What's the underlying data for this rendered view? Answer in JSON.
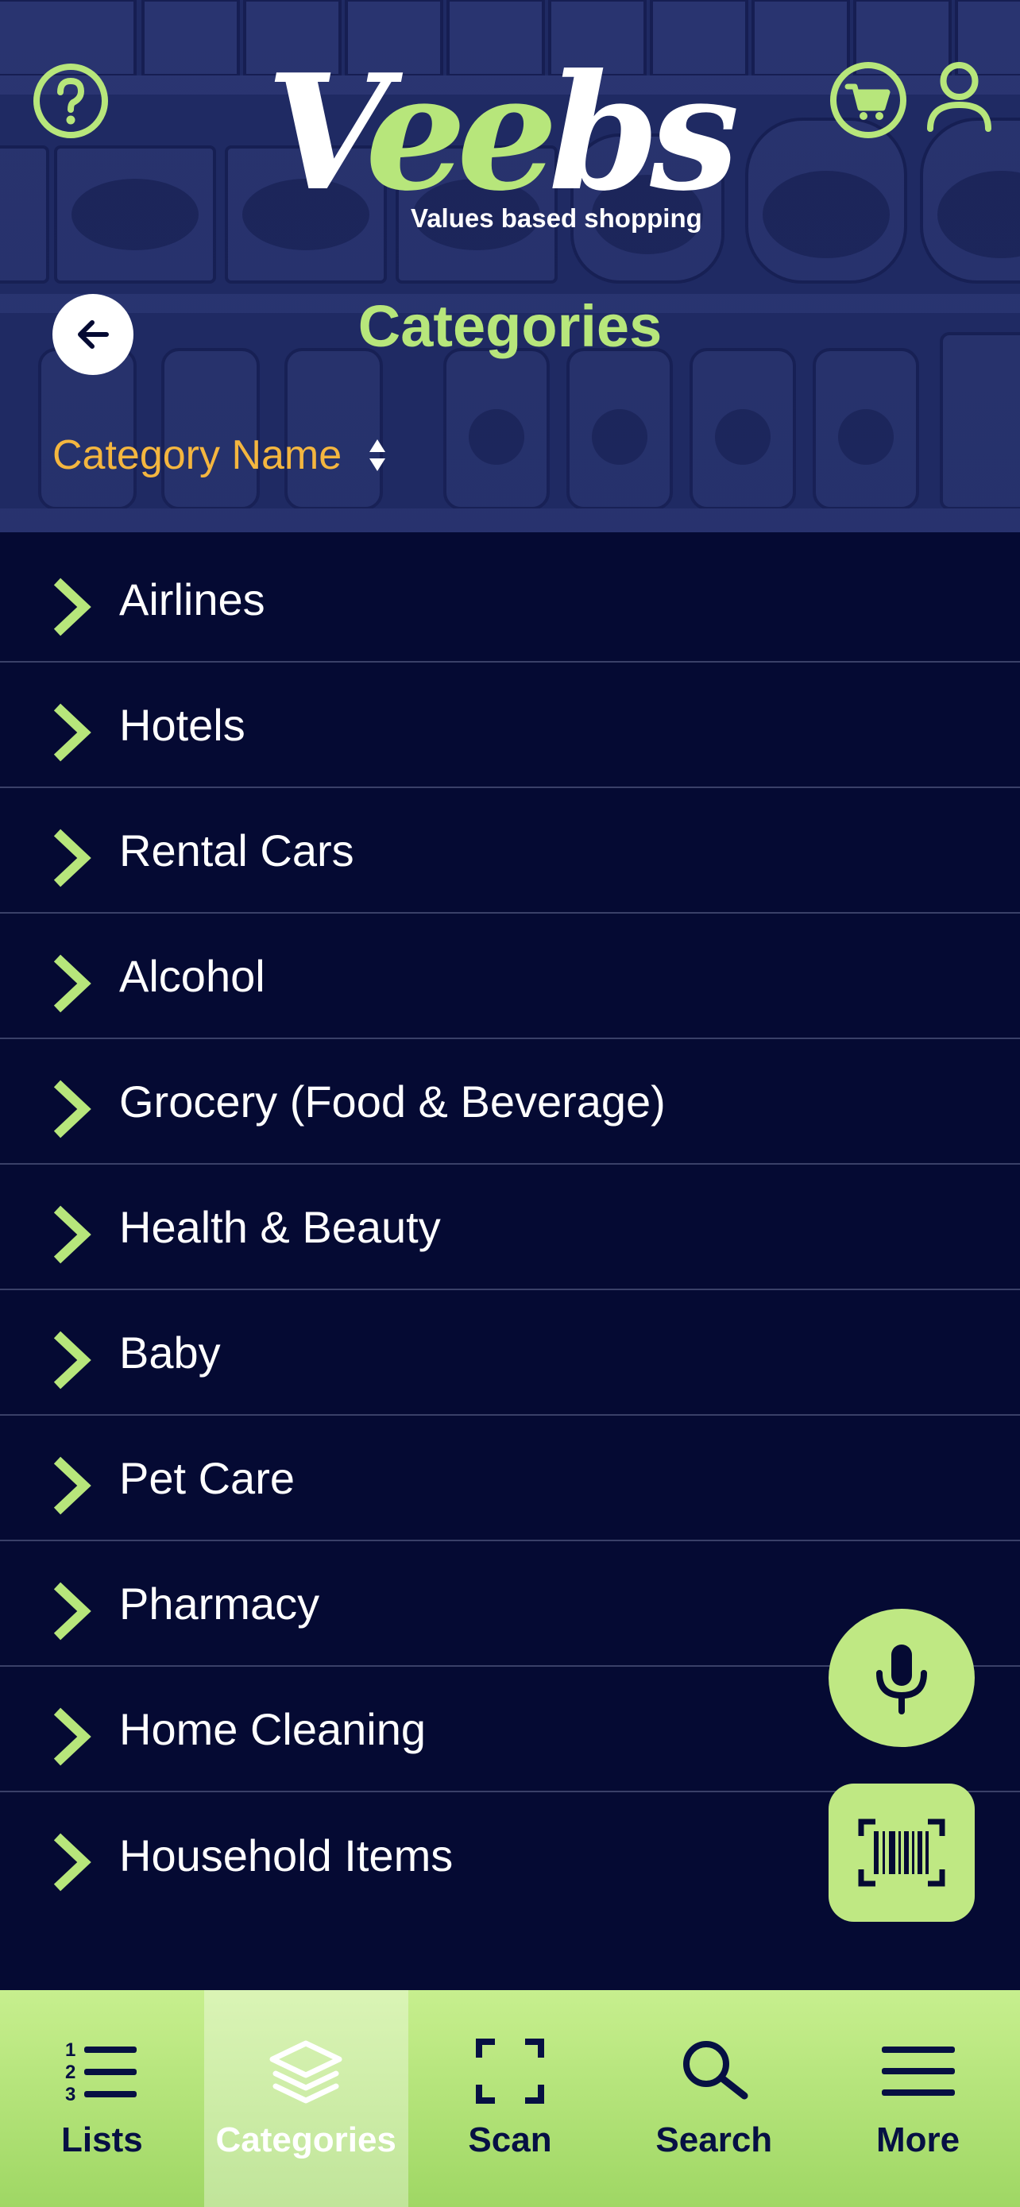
{
  "colors": {
    "background": "#050a33",
    "header_bg": "#1f2a63",
    "accent_green": "#b7e67b",
    "sort_orange": "#f4b63f",
    "nav_text": "#061043"
  },
  "header": {
    "help_icon": "question-circle-icon",
    "cart_icon": "cart-icon",
    "user_icon": "user-icon",
    "logo": {
      "word_part1": "V",
      "word_part2": "ee",
      "word_part3": "bs",
      "tagline": "Values based shopping"
    },
    "back_icon": "arrow-left-icon",
    "title": "Categories"
  },
  "sort": {
    "label": "Category Name",
    "icon": "sort-arrows-icon"
  },
  "categories": [
    {
      "label": "Airlines"
    },
    {
      "label": "Hotels"
    },
    {
      "label": "Rental Cars"
    },
    {
      "label": "Alcohol"
    },
    {
      "label": "Grocery (Food & Beverage)"
    },
    {
      "label": "Health & Beauty"
    },
    {
      "label": "Baby"
    },
    {
      "label": "Pet Care"
    },
    {
      "label": "Pharmacy"
    },
    {
      "label": "Home Cleaning"
    },
    {
      "label": "Household Items"
    }
  ],
  "fabs": {
    "mic_icon": "microphone-icon",
    "barcode_icon": "barcode-icon"
  },
  "bottom_nav": {
    "items": [
      {
        "label": "Lists",
        "icon": "numbered-list-icon",
        "active": false
      },
      {
        "label": "Categories",
        "icon": "layers-icon",
        "active": true
      },
      {
        "label": "Scan",
        "icon": "scan-frame-icon",
        "active": false
      },
      {
        "label": "Search",
        "icon": "search-icon",
        "active": false
      },
      {
        "label": "More",
        "icon": "menu-icon",
        "active": false
      }
    ]
  }
}
